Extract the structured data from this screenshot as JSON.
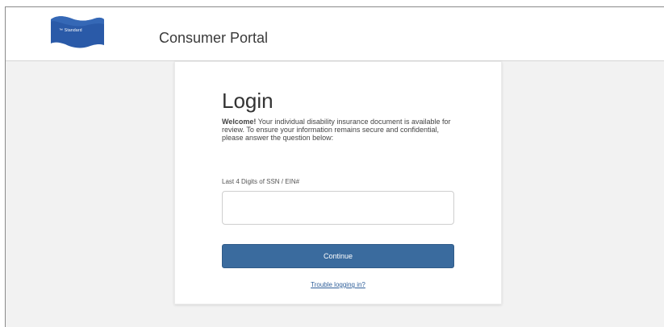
{
  "header": {
    "logo_text": "™ Standard",
    "portal_title": "Consumer Portal"
  },
  "login": {
    "title": "Login",
    "welcome_bold": "Welcome!",
    "welcome_text": " Your individual disability insurance document is available for review. To ensure your information remains secure and confidential, please answer the question below:",
    "ssn_label": "Last 4 Digits of SSN / EIN#",
    "ssn_value": "",
    "continue_label": "Continue",
    "trouble_link": "Trouble logging in?"
  },
  "colors": {
    "brand_blue": "#3a6b9e",
    "logo_blue": "#2a5aa8",
    "link_blue": "#2f5f9a"
  }
}
